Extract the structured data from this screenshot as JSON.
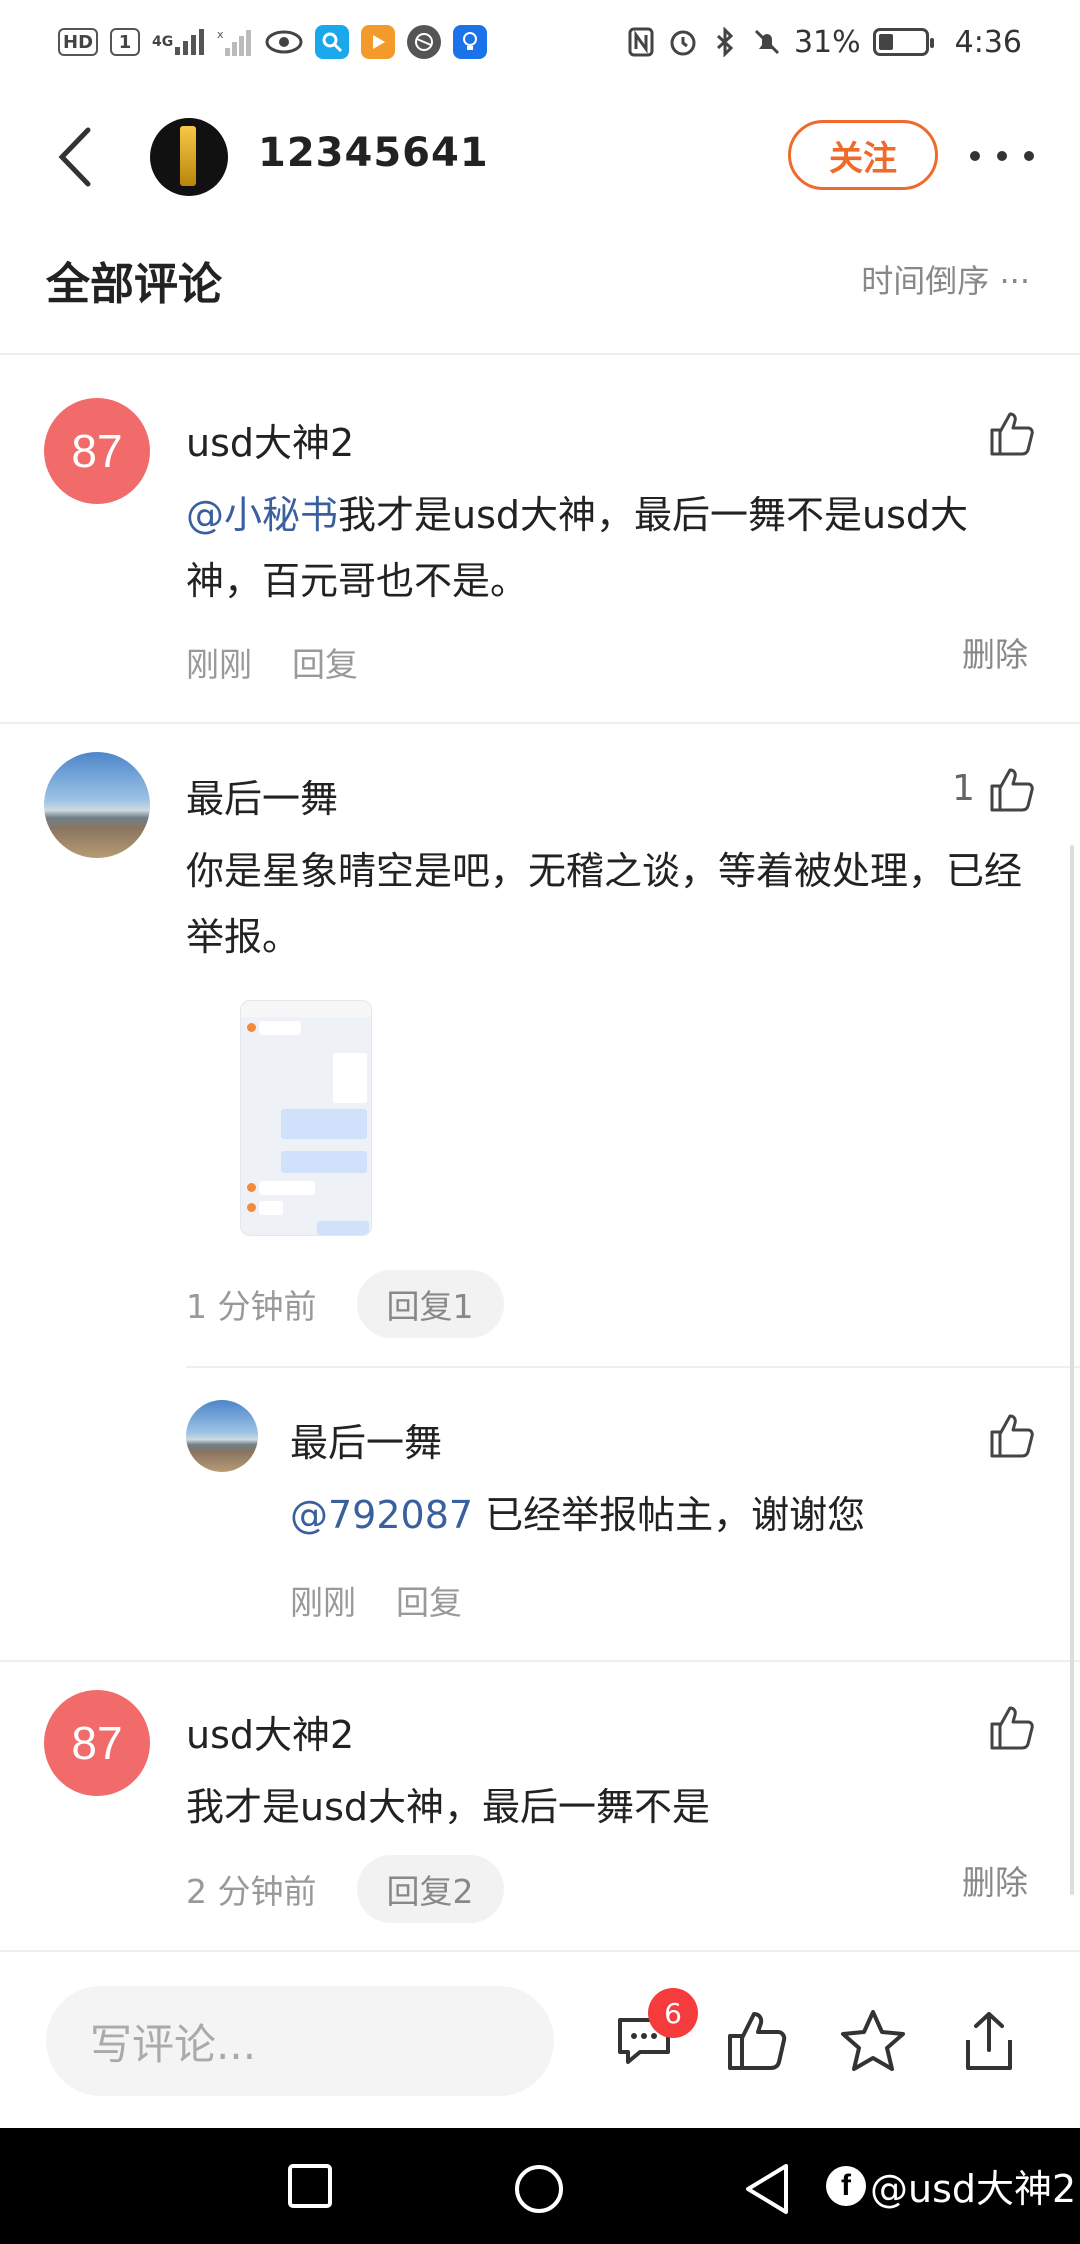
{
  "status_bar": {
    "hd_label": "HD",
    "sim_label": "1",
    "signal_label": "4G",
    "battery_percent": "31%",
    "battery_level": 0.31,
    "time": "4:36"
  },
  "header": {
    "username": "12345641",
    "follow_label": "关注"
  },
  "section": {
    "title": "全部评论",
    "sort_label": "时间倒序"
  },
  "comments": [
    {
      "avatar_text": "87",
      "author": "usd大神2",
      "mention": "@小秘书",
      "text": "我才是usd大神，最后一舞不是usd大神，百元哥也不是。",
      "time": "刚刚",
      "reply_label": "回复",
      "delete_label": "删除"
    },
    {
      "author": "最后一舞",
      "text": "你是星象晴空是吧，无稽之谈，等着被处理，已经举报。",
      "likes": "1",
      "time": "1 分钟前",
      "reply_label": "回复1",
      "reply": {
        "author": "最后一舞",
        "mention": "@792087",
        "text": " 已经举报帖主，谢谢您",
        "time": "刚刚",
        "reply_label": "回复"
      }
    },
    {
      "avatar_text": "87",
      "author": "usd大神2",
      "text": "我才是usd大神，最后一舞不是",
      "time": "2 分钟前",
      "reply_label": "回复2",
      "delete_label": "删除"
    }
  ],
  "action_bar": {
    "input_placeholder": "写评论...",
    "comment_badge": "6"
  },
  "watermark": {
    "text": "@usd大神2",
    "logo_letter": "f"
  },
  "colors": {
    "accent": "#f06a2b",
    "avatar_red": "#f16b6b",
    "mention": "#3a5f9e",
    "badge": "#f53b3b"
  }
}
